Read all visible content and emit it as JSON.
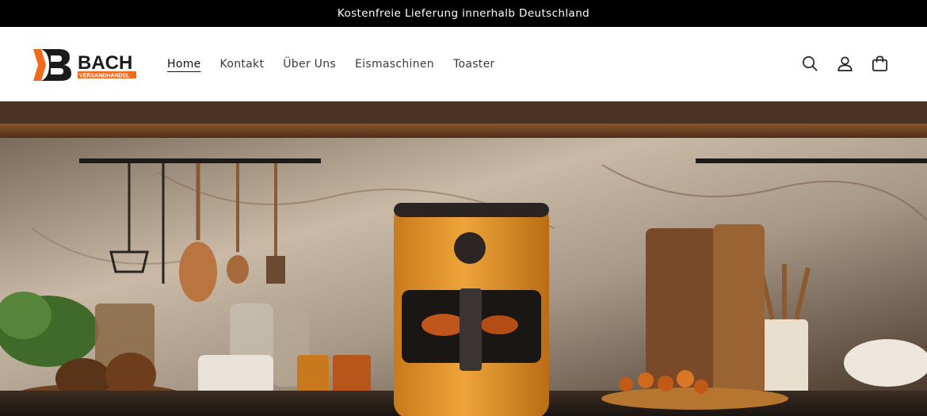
{
  "announcement": {
    "text": "Kostenfreie Lieferung innerhalb Deutschland"
  },
  "brand": {
    "name": "BACH",
    "tagline": "VERSANDHANDEL",
    "accent": "#f26b1d"
  },
  "nav": {
    "items": [
      {
        "label": "Home",
        "active": true
      },
      {
        "label": "Kontakt"
      },
      {
        "label": "Über Uns"
      },
      {
        "label": "Eismaschinen"
      },
      {
        "label": "Toaster"
      }
    ]
  },
  "header_icons": [
    "search-icon",
    "account-icon",
    "cart-icon"
  ]
}
